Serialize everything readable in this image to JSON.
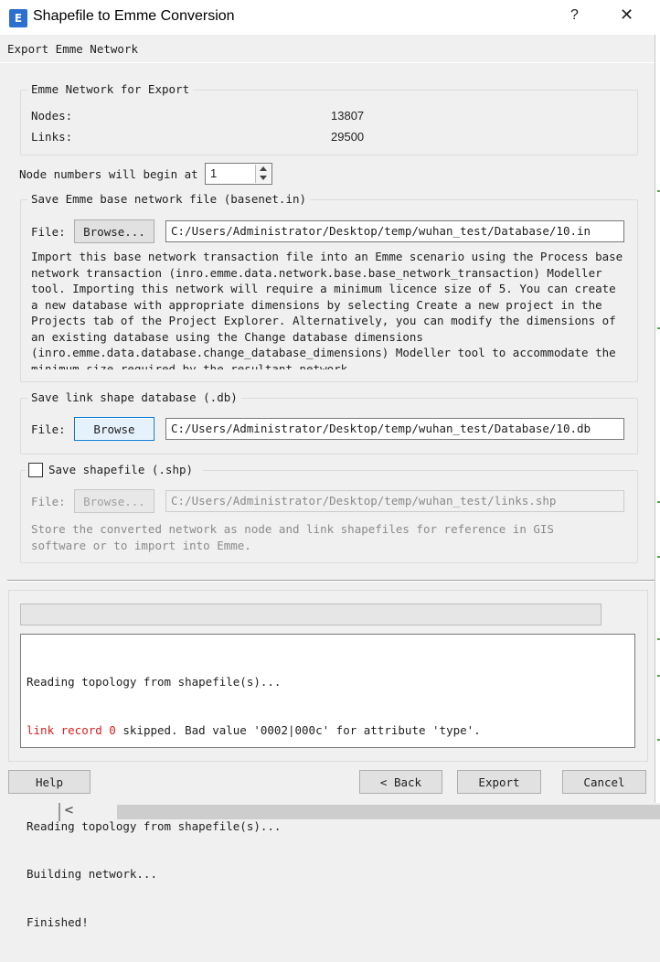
{
  "window": {
    "title": "Shapefile to Emme Conversion",
    "icon": "app-icon",
    "help_label": "?",
    "close_label": "✕"
  },
  "page": {
    "title": "Export Emme Network"
  },
  "network_group": {
    "title": "Emme Network for Export",
    "nodes_label": "Nodes:",
    "nodes_value": "13807",
    "links_label": "Links:",
    "links_value": "29500"
  },
  "node_start": {
    "label": "Node numbers will begin at",
    "value": "1"
  },
  "basenet_group": {
    "title": "Save Emme base network file (basenet.in)",
    "file_label": "File:",
    "browse_label": "Browse...",
    "path": "C:/Users/Administrator/Desktop/temp/wuhan_test/Database/10.in",
    "note": "Import this base network transaction file into an Emme scenario using the Process base\nnetwork transaction (inro.emme.data.network.base.base_network_transaction) Modeller\ntool. Importing this network will require a minimum licence size of 5. You can create\na new database with appropriate dimensions by selecting Create a new project in the\nProjects tab of the Project Explorer. Alternatively, you can modify the dimensions of\nan existing database using the Change database dimensions\n(inro.emme.data.database.change_database_dimensions) Modeller tool to accommodate the\nminimum size required by the resultant network."
  },
  "linkshape_group": {
    "title": "Save link shape database (.db)",
    "file_label": "File:",
    "browse_label": "Browse",
    "path": "C:/Users/Administrator/Desktop/temp/wuhan_test/Database/10.db"
  },
  "shapefile_group": {
    "title": "Save shapefile (.shp)",
    "checked": false,
    "file_label": "File:",
    "browse_label": "Browse...",
    "path": "C:/Users/Administrator/Desktop/temp/wuhan_test/links.shp",
    "note": "Store the converted network as node and link shapefiles for reference in GIS\nsoftware or to import into Emme."
  },
  "progress": {
    "value": 0
  },
  "log": {
    "line1": "Reading topology from shapefile(s)...",
    "line2_red": "link record 0",
    "line2_rest": " skipped. Bad value '0002|000c' for attribute 'type'.",
    "line3": "Reading topology from shapefile(s)...",
    "line4": "Building network...",
    "line5": "Finished!"
  },
  "buttons": {
    "help": "Help",
    "back": "< Back",
    "export": "Export",
    "cancel": "Cancel"
  },
  "scrollbar": {
    "left_arrow": "<"
  },
  "colors": {
    "error_text": "#e01b1b",
    "focus_border": "#0078d7"
  }
}
